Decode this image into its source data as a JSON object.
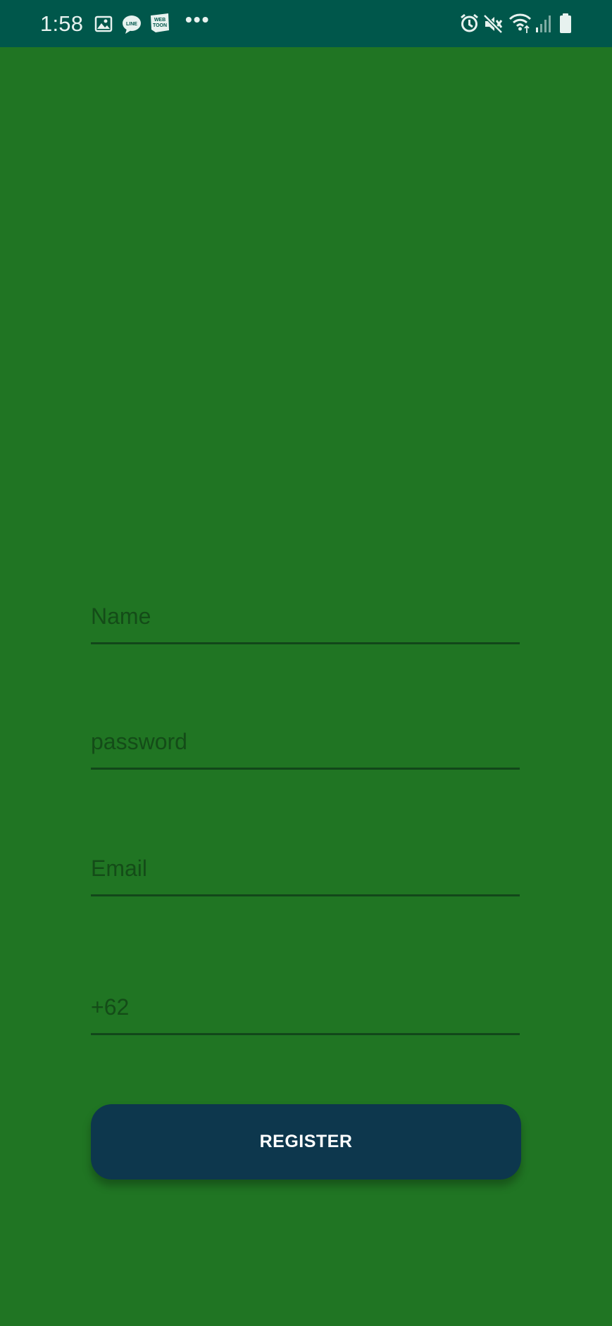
{
  "status_bar": {
    "time": "1:58",
    "notification_icons": [
      "image-icon",
      "line-app-icon",
      "webtoon-app-icon"
    ],
    "line_label": "LINE",
    "webtoon_label": "WEB TOON",
    "more_indicator": "•••",
    "system_icons": [
      "alarm-icon",
      "mute-icon",
      "wifi-icon",
      "signal-icon",
      "battery-icon"
    ]
  },
  "form": {
    "name_placeholder": "Name",
    "password_placeholder": "password",
    "email_placeholder": "Email",
    "phone_prefix": "+62"
  },
  "actions": {
    "register_label": "REGISTER"
  },
  "colors": {
    "background": "#207523",
    "status_bar": "#00574b",
    "button": "#0d374d",
    "field_text": "#144c18",
    "underline": "#12471a"
  }
}
